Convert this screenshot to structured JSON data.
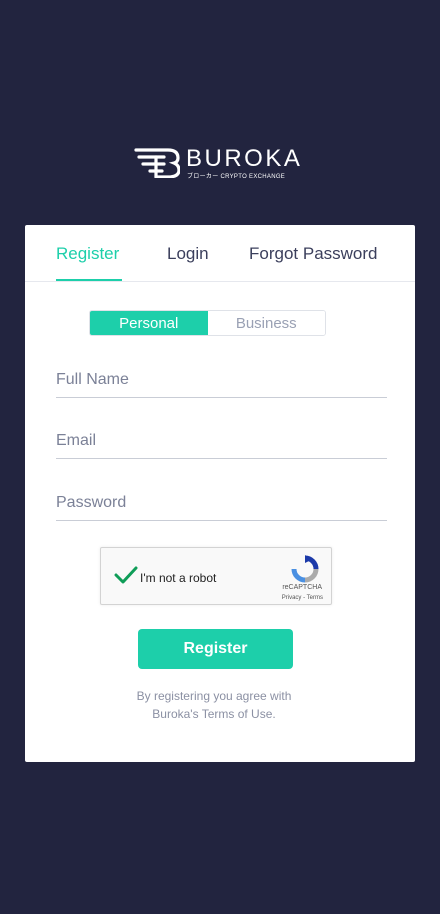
{
  "brand": {
    "name": "BUROKA",
    "tagline": "ブローカー CRYPTO EXCHANGE",
    "accent_color": "#1dcfaa",
    "background_color": "#22243f"
  },
  "tabs": [
    {
      "label": "Register",
      "active": true
    },
    {
      "label": "Login",
      "active": false
    },
    {
      "label": "Forgot Password",
      "active": false
    }
  ],
  "account_type": {
    "options": [
      "Personal",
      "Business"
    ],
    "selected": "Personal"
  },
  "form": {
    "full_name_placeholder": "Full Name",
    "email_placeholder": "Email",
    "password_placeholder": "Password"
  },
  "captcha": {
    "label": "I'm not a robot",
    "checked": true,
    "brand": "reCAPTCHA",
    "links": "Privacy - Terms"
  },
  "submit_label": "Register",
  "terms": {
    "line1": "By registering you agree with",
    "line2": "Buroka's Terms of Use."
  }
}
